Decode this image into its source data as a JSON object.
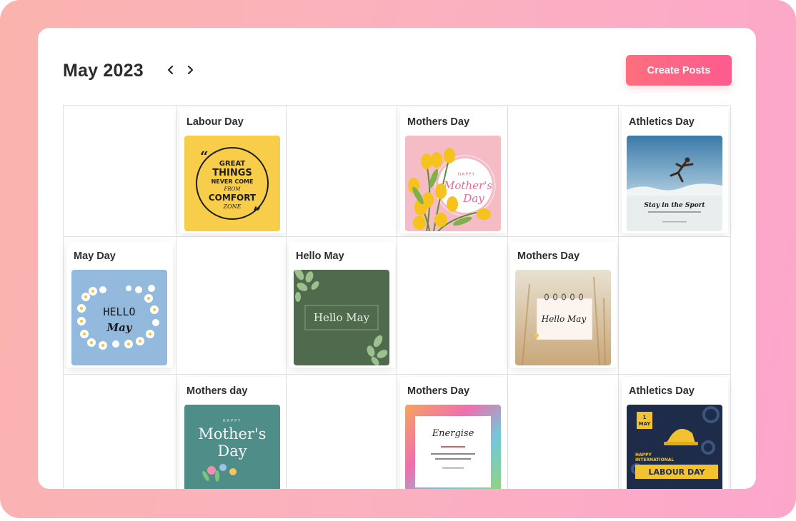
{
  "calendar": {
    "month_label": "May",
    "year_label": "2023",
    "create_button_label": "Create Posts"
  },
  "posts": {
    "labour_day": {
      "title": "Labour Day",
      "art_text": [
        "GREAT",
        "THINGS",
        "NEVER COME",
        "FROM",
        "COMFORT",
        "ZONE"
      ]
    },
    "mothers_day_1": {
      "title": "Mothers Day",
      "art_text": [
        "HAPPY",
        "Mother's",
        "Day"
      ]
    },
    "athletics_day_1": {
      "title": "Athletics Day",
      "art_text": [
        "Stay in the Sport"
      ]
    },
    "may_day": {
      "title": "May Day",
      "art_text": [
        "HELLO",
        "May"
      ]
    },
    "hello_may": {
      "title": "Hello May",
      "art_text": [
        "Hello May"
      ]
    },
    "mothers_day_2": {
      "title": "Mothers Day",
      "art_text": [
        "Hello May"
      ]
    },
    "mothers_day_3": {
      "title": "Mothers day",
      "art_text": [
        "HAPPY",
        "Mother's",
        "Day"
      ]
    },
    "mothers_day_4": {
      "title": "Mothers Day",
      "art_text": [
        "Energise"
      ]
    },
    "athletics_day_2": {
      "title": "Athletics Day",
      "art_text": [
        "1",
        "MAY",
        "HAPPY",
        "INTERNATIONAL",
        "LABOUR DAY"
      ]
    }
  },
  "colors": {
    "accent_start": "#fd6f7e",
    "accent_end": "#fd5b8f",
    "background_gradient": [
      "#fbb3ae",
      "#fca6cc"
    ]
  },
  "icons": [
    "chevron-left-icon",
    "chevron-right-icon"
  ]
}
